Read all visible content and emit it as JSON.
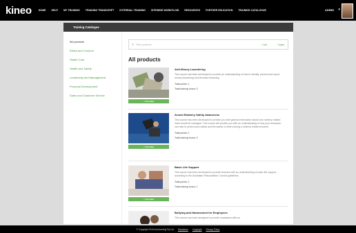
{
  "brand": {
    "logo": "kineo"
  },
  "nav": {
    "items": [
      "HOME",
      "HELP",
      "MY TRAINING",
      "TRAINING TRANSCRIPT",
      "EXTERNAL TRAINING",
      "SITEWIDE WORKFLOW",
      "RESOURCES",
      "FURTHER EDUCATION",
      "TRAINING CATALOGUE"
    ]
  },
  "user": {
    "name": "ADMIN"
  },
  "page": {
    "card_title": "Training Catalogue",
    "heading": "All products"
  },
  "sidebar": {
    "items": [
      "All products",
      "Ethics and Conduct",
      "Health Care",
      "Health and Safety",
      "Leadership and Management",
      "Personal Development",
      "Sales and Customer Service"
    ]
  },
  "search": {
    "placeholder": "Filter products",
    "sort_label": "+ sort",
    "filter_label": "+ types"
  },
  "courses": [
    {
      "title": "Anti-Money Laundering",
      "desc": "This course has been developed to provide an understanding of how to identify, prevent and report money laundering and terrorism financing.",
      "points": "Total points: 1",
      "hours": "Total training hours: 3",
      "enrol": "✓ Enrolled"
    },
    {
      "title": "Armed Robbery Safety Awareness",
      "desc": "This course has been developed to provide you with general information about how robbery related risks should be managed. This course will provide you with an understanding of how your behaviour can help to protect your safety and the safety of others during a robbery related incident.",
      "points": "Total points: 1",
      "hours": "Total training hours: 3",
      "enrol": "✓ Enrolled"
    },
    {
      "title": "Basic Life Support",
      "desc": "This course has been developed to provide learners with an understanding of basic life support, according to the Australian Resuscitation Council guidelines.",
      "points": "Total points: 1",
      "hours": "Total training hours: 1",
      "enrol": "✓ Enrolled"
    },
    {
      "title": "Bullying and Harassment for Employees",
      "desc": "This course has been designed to provide employees with an",
      "points": "",
      "hours": "",
      "enrol": ""
    }
  ],
  "footer": {
    "copyright": "© Copyright 2018 eduLearning Pty Ltd",
    "disclaimer": "Disclaimer",
    "copyright_link": "Copyright",
    "privacy": "Privacy Policy"
  }
}
